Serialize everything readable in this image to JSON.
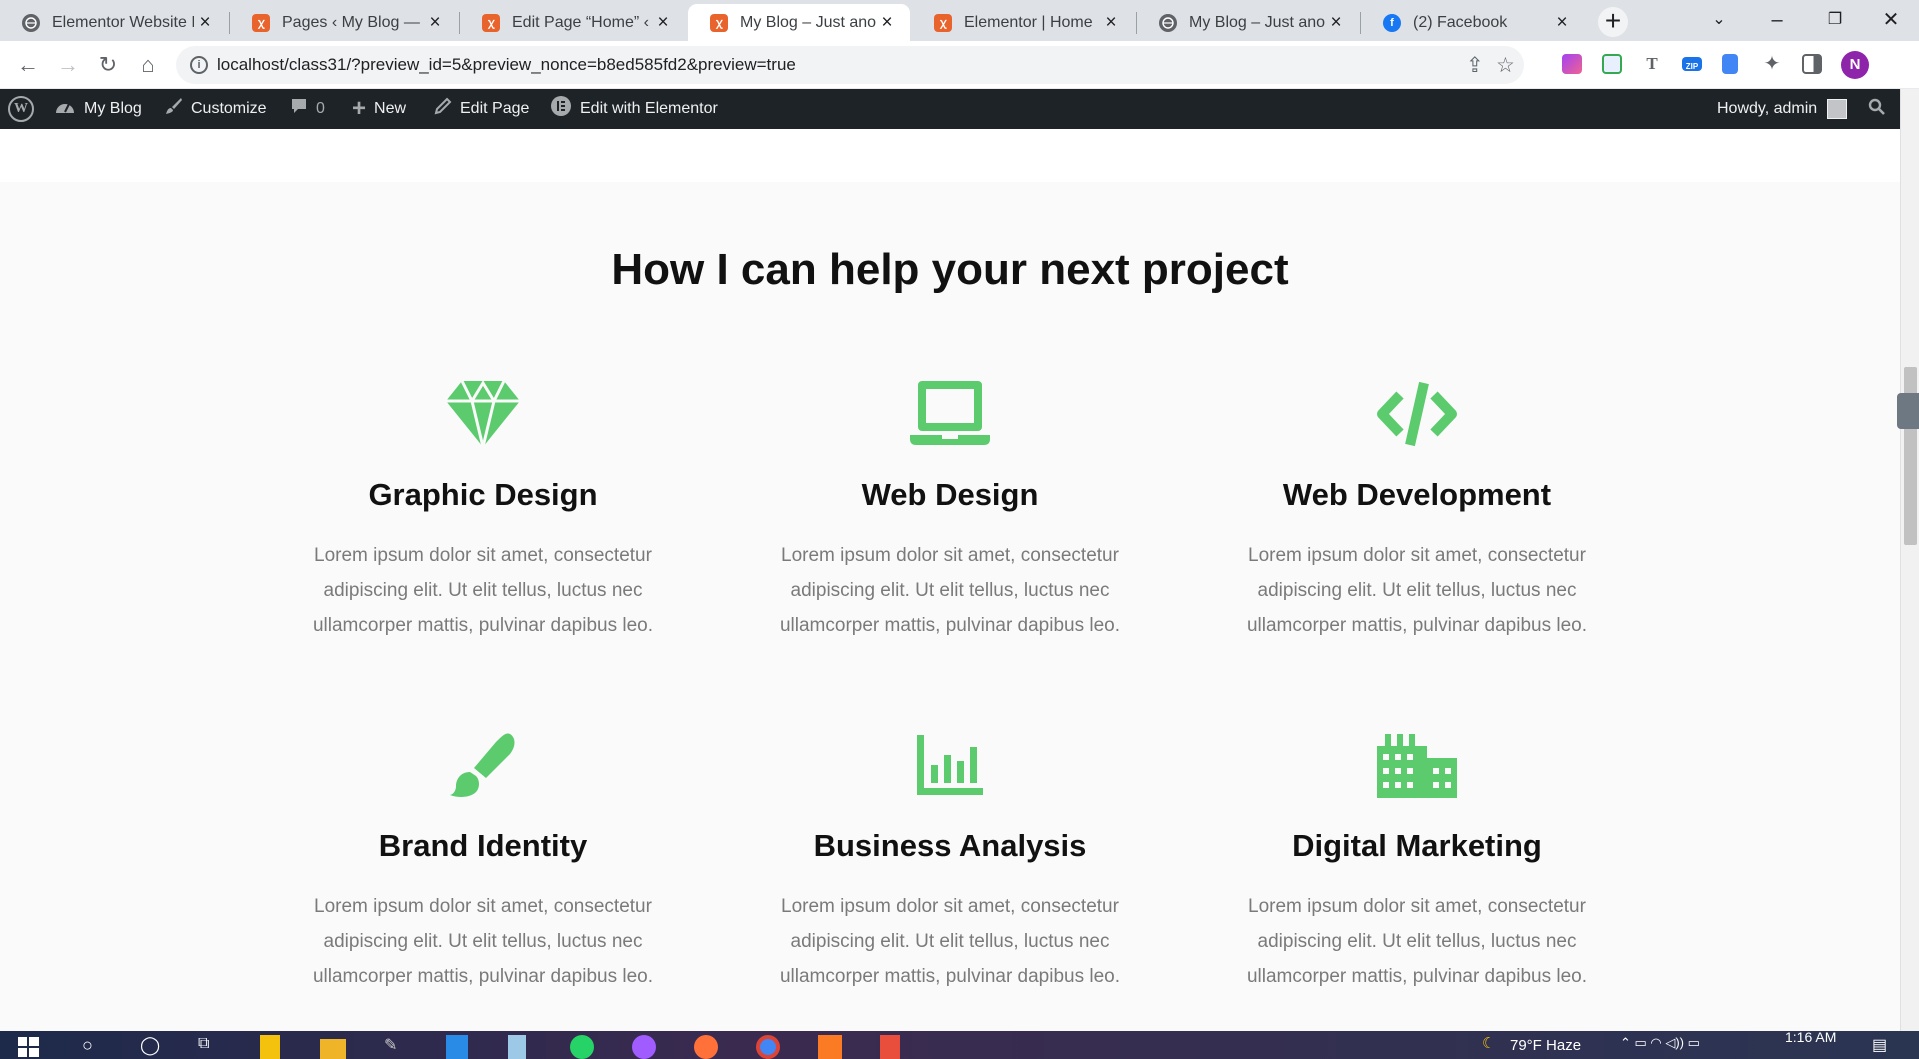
{
  "browser": {
    "tabs": [
      {
        "title": "Elementor Website Bu",
        "favicon": "globe-icon",
        "active": false
      },
      {
        "title": "Pages ‹ My Blog — W",
        "favicon": "xampp-icon",
        "active": false
      },
      {
        "title": "Edit Page “Home” ‹ M",
        "favicon": "xampp-icon",
        "active": false
      },
      {
        "title": "My Blog – Just anothe",
        "favicon": "xampp-icon",
        "active": true
      },
      {
        "title": "Elementor | Home",
        "favicon": "xampp-icon",
        "active": false
      },
      {
        "title": "My Blog – Just anothe",
        "favicon": "globe-icon",
        "active": false
      },
      {
        "title": "(2) Facebook",
        "favicon": "facebook-icon",
        "active": false
      }
    ],
    "url": "localhost/class31/?preview_id=5&preview_nonce=b8ed585fd2&preview=true",
    "profile_initial": "N"
  },
  "adminbar": {
    "site_name": "My Blog",
    "customize": "Customize",
    "comments_count": "0",
    "new": "New",
    "edit_page": "Edit Page",
    "edit_elementor": "Edit with Elementor",
    "howdy": "Howdy, admin"
  },
  "section": {
    "title": "How I can help your next project",
    "services": [
      {
        "title": "Graphic Design",
        "icon": "gem-icon",
        "text": "Lorem ipsum dolor sit amet, consectetur adipiscing elit. Ut elit tellus, luctus nec ullamcorper mattis, pulvinar dapibus leo."
      },
      {
        "title": "Web Design",
        "icon": "laptop-icon",
        "text": "Lorem ipsum dolor sit amet, consectetur adipiscing elit. Ut elit tellus, luctus nec ullamcorper mattis, pulvinar dapibus leo."
      },
      {
        "title": "Web Development",
        "icon": "code-icon",
        "text": "Lorem ipsum dolor sit amet, consectetur adipiscing elit. Ut elit tellus, luctus nec ullamcorper mattis, pulvinar dapibus leo."
      },
      {
        "title": "Brand Identity",
        "icon": "paint-brush-icon",
        "text": "Lorem ipsum dolor sit amet, consectetur adipiscing elit. Ut elit tellus, luctus nec ullamcorper mattis, pulvinar dapibus leo."
      },
      {
        "title": "Business Analysis",
        "icon": "chart-icon",
        "text": "Lorem ipsum dolor sit amet, consectetur adipiscing elit. Ut elit tellus, luctus nec ullamcorper mattis, pulvinar dapibus leo."
      },
      {
        "title": "Digital Marketing",
        "icon": "building-icon",
        "text": "Lorem ipsum dolor sit amet, consectetur adipiscing elit. Ut elit tellus, luctus nec ullamcorper mattis, pulvinar dapibus leo."
      }
    ]
  },
  "taskbar": {
    "weather": "79°F  Haze",
    "time": "1:16 AM"
  },
  "colors": {
    "accent": "#5ccb6e",
    "adminbar": "#1d2327"
  }
}
